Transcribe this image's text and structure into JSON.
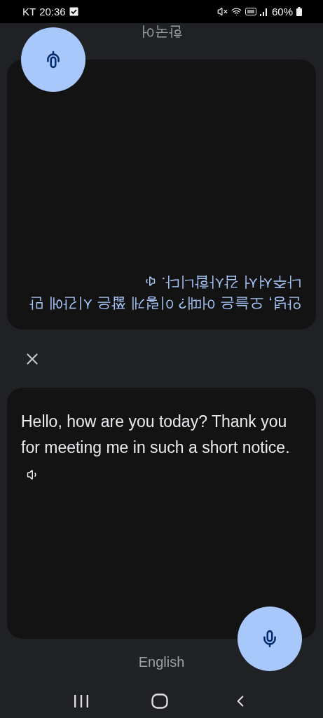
{
  "status_bar": {
    "carrier": "KT",
    "time": "20:36",
    "battery": "60%"
  },
  "sides": [
    {
      "language": "한국어",
      "text": "안녕, 오늘은 어때? 이렇게 짧은 시간에 만나주셔서 감사합니다.",
      "kind": "translation",
      "flipped": true
    },
    {
      "language": "English",
      "text": "Hello, how are you today? Thank you for meeting me in such a short notice.",
      "kind": "source",
      "flipped": false
    }
  ]
}
